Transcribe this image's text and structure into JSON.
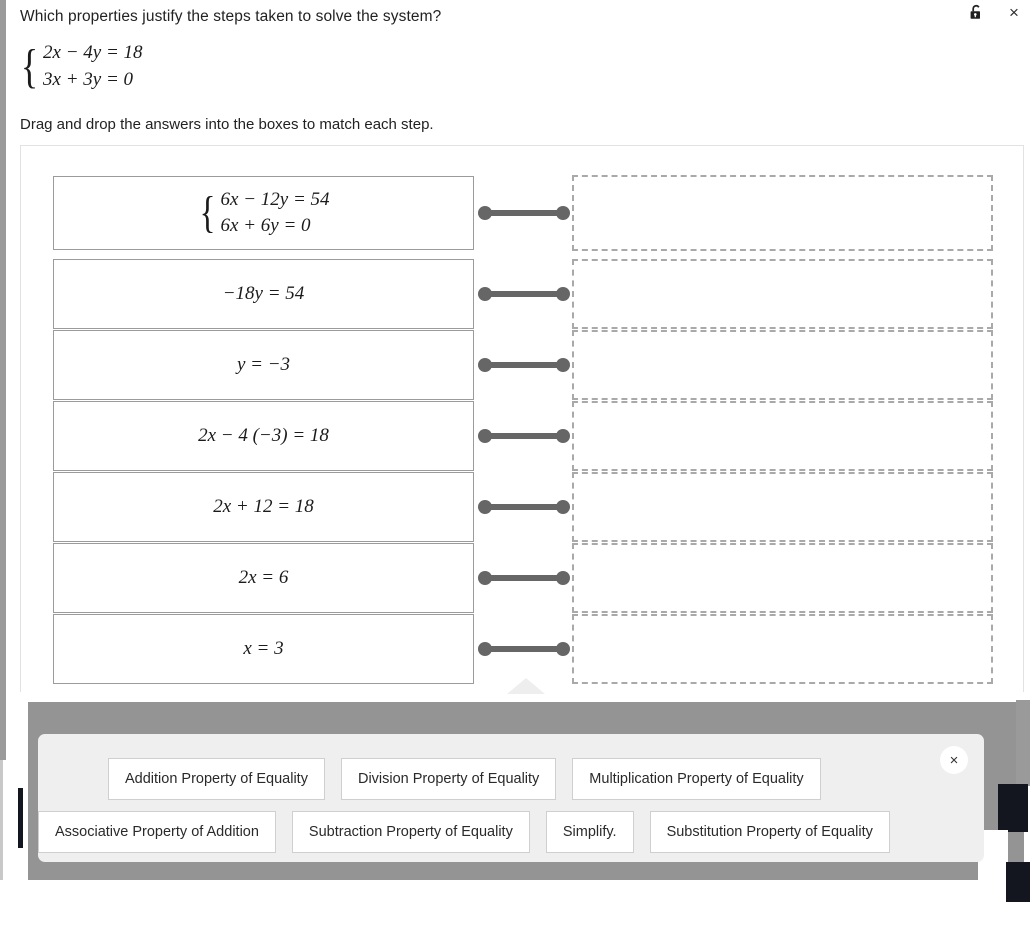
{
  "window": {
    "lock_icon": "unlock-icon",
    "close_icon": "close-icon",
    "close_label": "×"
  },
  "header": {
    "question": "Which properties justify the steps taken to solve the system?",
    "instruction": "Drag and drop the answers into the boxes to match each step.",
    "system": {
      "brace": "{",
      "equations": [
        "2x − 4y = 18",
        "3x + 3y = 0"
      ]
    }
  },
  "steps": [
    {
      "type": "system",
      "brace": "{",
      "equations": [
        "6x − 12y = 54",
        "6x + 6y = 0"
      ],
      "drop_value": ""
    },
    {
      "type": "single",
      "equation": "−18y = 54",
      "drop_value": ""
    },
    {
      "type": "single",
      "equation": "y = −3",
      "drop_value": ""
    },
    {
      "type": "single",
      "equation": "2x − 4 (−3) = 18",
      "drop_value": ""
    },
    {
      "type": "single",
      "equation": "2x + 12 = 18",
      "drop_value": ""
    },
    {
      "type": "single",
      "equation": "2x = 6",
      "drop_value": ""
    },
    {
      "type": "single",
      "equation": "x = 3",
      "drop_value": ""
    }
  ],
  "answer_bank": {
    "close_label": "×",
    "row1": [
      "Addition Property of Equality",
      "Division Property of Equality",
      "Multiplication Property of Equality"
    ],
    "row2": [
      "Associative Property of Addition",
      "Subtraction Property of Equality",
      "Simplify.",
      "Substitution Property of Equality"
    ]
  },
  "colors": {
    "connector": "#666666",
    "dropzone_border": "#a9a9a9",
    "bank_bg": "#efefef",
    "backdrop": "#949494"
  }
}
